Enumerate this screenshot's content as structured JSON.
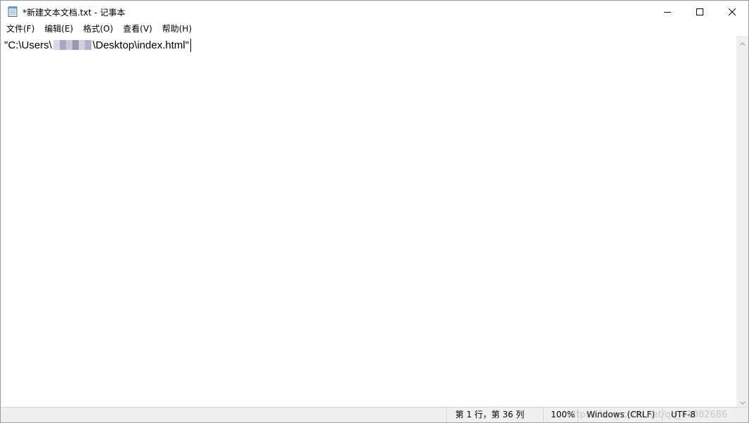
{
  "window": {
    "title": "*新建文本文档.txt - 记事本"
  },
  "icons": {
    "app": "notepad-icon",
    "minimize": "minimize-icon",
    "maximize": "maximize-icon",
    "close": "close-icon",
    "scroll_up": "chevron-up-icon",
    "scroll_down": "chevron-down-icon"
  },
  "menu": {
    "items": [
      {
        "label": "文件(F)"
      },
      {
        "label": "编辑(E)"
      },
      {
        "label": "格式(O)"
      },
      {
        "label": "查看(V)"
      },
      {
        "label": "帮助(H)"
      }
    ]
  },
  "editor": {
    "text_before": "\"C:\\Users\\",
    "text_after": "\\Desktop\\index.html\""
  },
  "statusbar": {
    "position": "第 1 行，第 36 列",
    "zoom": "100%",
    "line_ending": "Windows (CRLF)",
    "encoding": "UTF-8",
    "watermark": "https://blog.csdn.net/qq_41082686"
  },
  "colors": {
    "close_hover": "#e81123",
    "statusbar_bg": "#f0f0f0"
  }
}
